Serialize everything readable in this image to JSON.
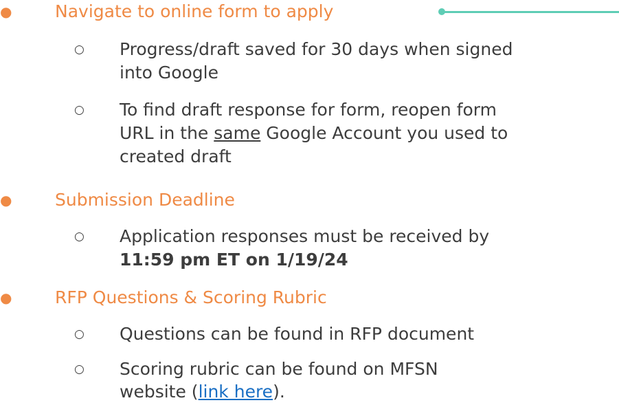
{
  "bullets": {
    "level1": "●",
    "level2": "○"
  },
  "colors": {
    "heading": "#ef8a45",
    "body": "#3d3d3d",
    "link": "#1a6fc4",
    "accent": "#5ecdb5"
  },
  "sections": [
    {
      "heading": "Navigate to online form to apply",
      "items": [
        {
          "line1": "Progress/draft saved for 30 days when signed",
          "line2": "into Google"
        },
        {
          "line1": "To find draft response for form, reopen form",
          "line2_pre": "URL in the ",
          "line2_underlined": "same",
          "line2_post": " Google Account you used to",
          "line3": "created draft"
        }
      ]
    },
    {
      "heading": "Submission Deadline",
      "items": [
        {
          "line1": "Application responses must be received by",
          "line2_bold": "11:59 pm ET on 1/19/24"
        }
      ]
    },
    {
      "heading": "RFP Questions & Scoring Rubric",
      "items": [
        {
          "line1": "Questions can be found in RFP document"
        },
        {
          "line1": "Scoring rubric can be found on MFSN",
          "line2_pre": "website (",
          "line2_link": "link here",
          "line2_post": ")."
        }
      ]
    }
  ]
}
